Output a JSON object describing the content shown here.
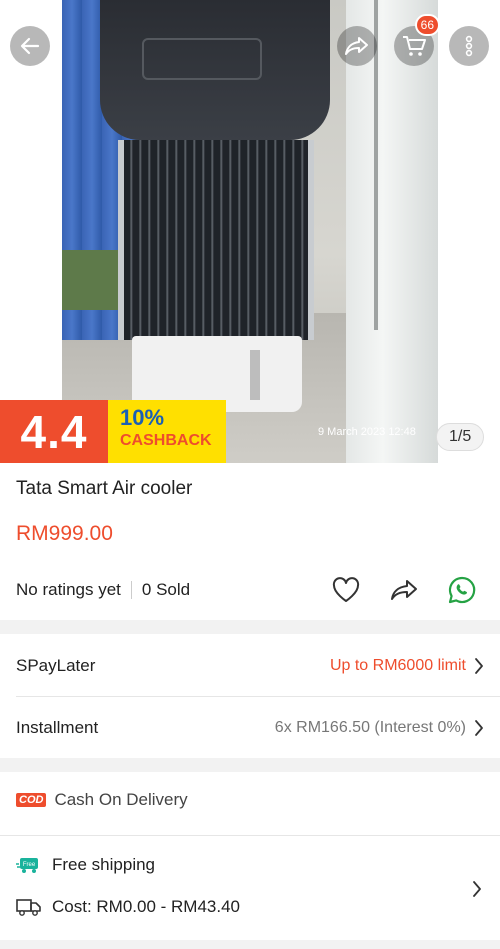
{
  "image": {
    "timestamp": "9 March 2023 12:48",
    "counter": "1/5"
  },
  "header": {
    "cart_count": "66"
  },
  "promo": {
    "big": "4.4",
    "percent": "10%",
    "cashback": "CASHBACK"
  },
  "product": {
    "title": "Tata Smart Air cooler",
    "price": "RM999.00",
    "rating": "No ratings yet",
    "sold": "0 Sold"
  },
  "payment": {
    "spaylater_label": "SPayLater",
    "spaylater_value": "Up to RM6000 limit",
    "installment_label": "Installment",
    "installment_value": "6x RM166.50 (Interest 0%)"
  },
  "delivery": {
    "cod_badge": "COD",
    "cod_label": "Cash On Delivery",
    "free_shipping_tag": "Free",
    "free_shipping": "Free shipping",
    "cost": "Cost: RM0.00 - RM43.40"
  },
  "colors": {
    "accent": "#ee4d2d",
    "whatsapp": "#25a244",
    "promo_yellow": "#ffe000"
  },
  "icons": [
    "back-arrow-icon",
    "share-icon",
    "cart-icon",
    "more-vertical-icon",
    "heart-icon",
    "share-outline-icon",
    "whatsapp-icon",
    "chevron-right-icon",
    "free-shipping-icon",
    "truck-icon"
  ]
}
